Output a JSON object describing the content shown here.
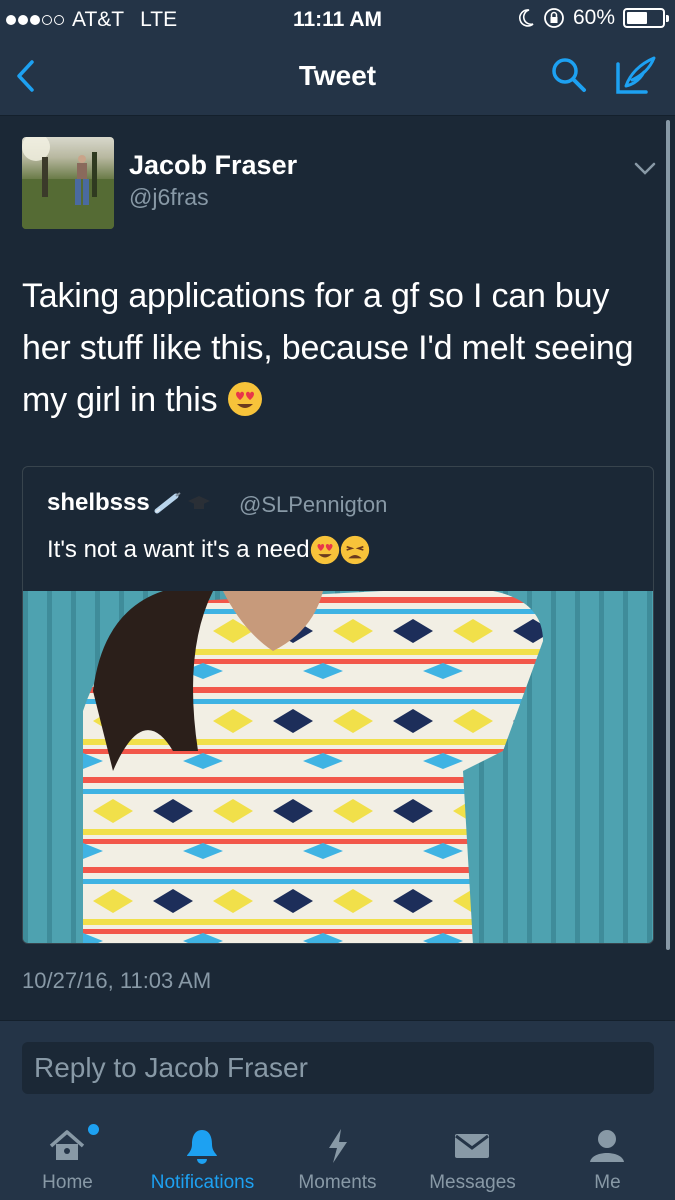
{
  "status_bar": {
    "carrier": "AT&T",
    "network": "LTE",
    "time": "11:11 AM",
    "battery": "60%",
    "battery_level": 0.6,
    "signal_bars": 3
  },
  "nav": {
    "title": "Tweet",
    "back_icon": "chevron-left-icon",
    "search_icon": "search-icon",
    "compose_icon": "compose-icon"
  },
  "tweet": {
    "author_name": "Jacob Fraser",
    "author_handle": "@j6fras",
    "text": "Taking applications for a gf so I can buy her stuff like this, because I'd melt seeing my girl in this",
    "timestamp": "10/27/16, 11:03 AM"
  },
  "quoted_tweet": {
    "author_name": "shelbsss",
    "author_handle": "@SLPennigton",
    "text": "It's not a want it's a need"
  },
  "reply": {
    "placeholder": "Reply to Jacob Fraser"
  },
  "tabs": [
    {
      "label": "Home",
      "icon": "home-icon"
    },
    {
      "label": "Notifications",
      "icon": "bell-icon"
    },
    {
      "label": "Moments",
      "icon": "lightning-icon"
    },
    {
      "label": "Messages",
      "icon": "envelope-icon"
    },
    {
      "label": "Me",
      "icon": "person-icon"
    }
  ],
  "colors": {
    "background": "#1b2836",
    "bar": "#243447",
    "accent": "#1da1f2",
    "secondary_text": "#8899a6"
  }
}
